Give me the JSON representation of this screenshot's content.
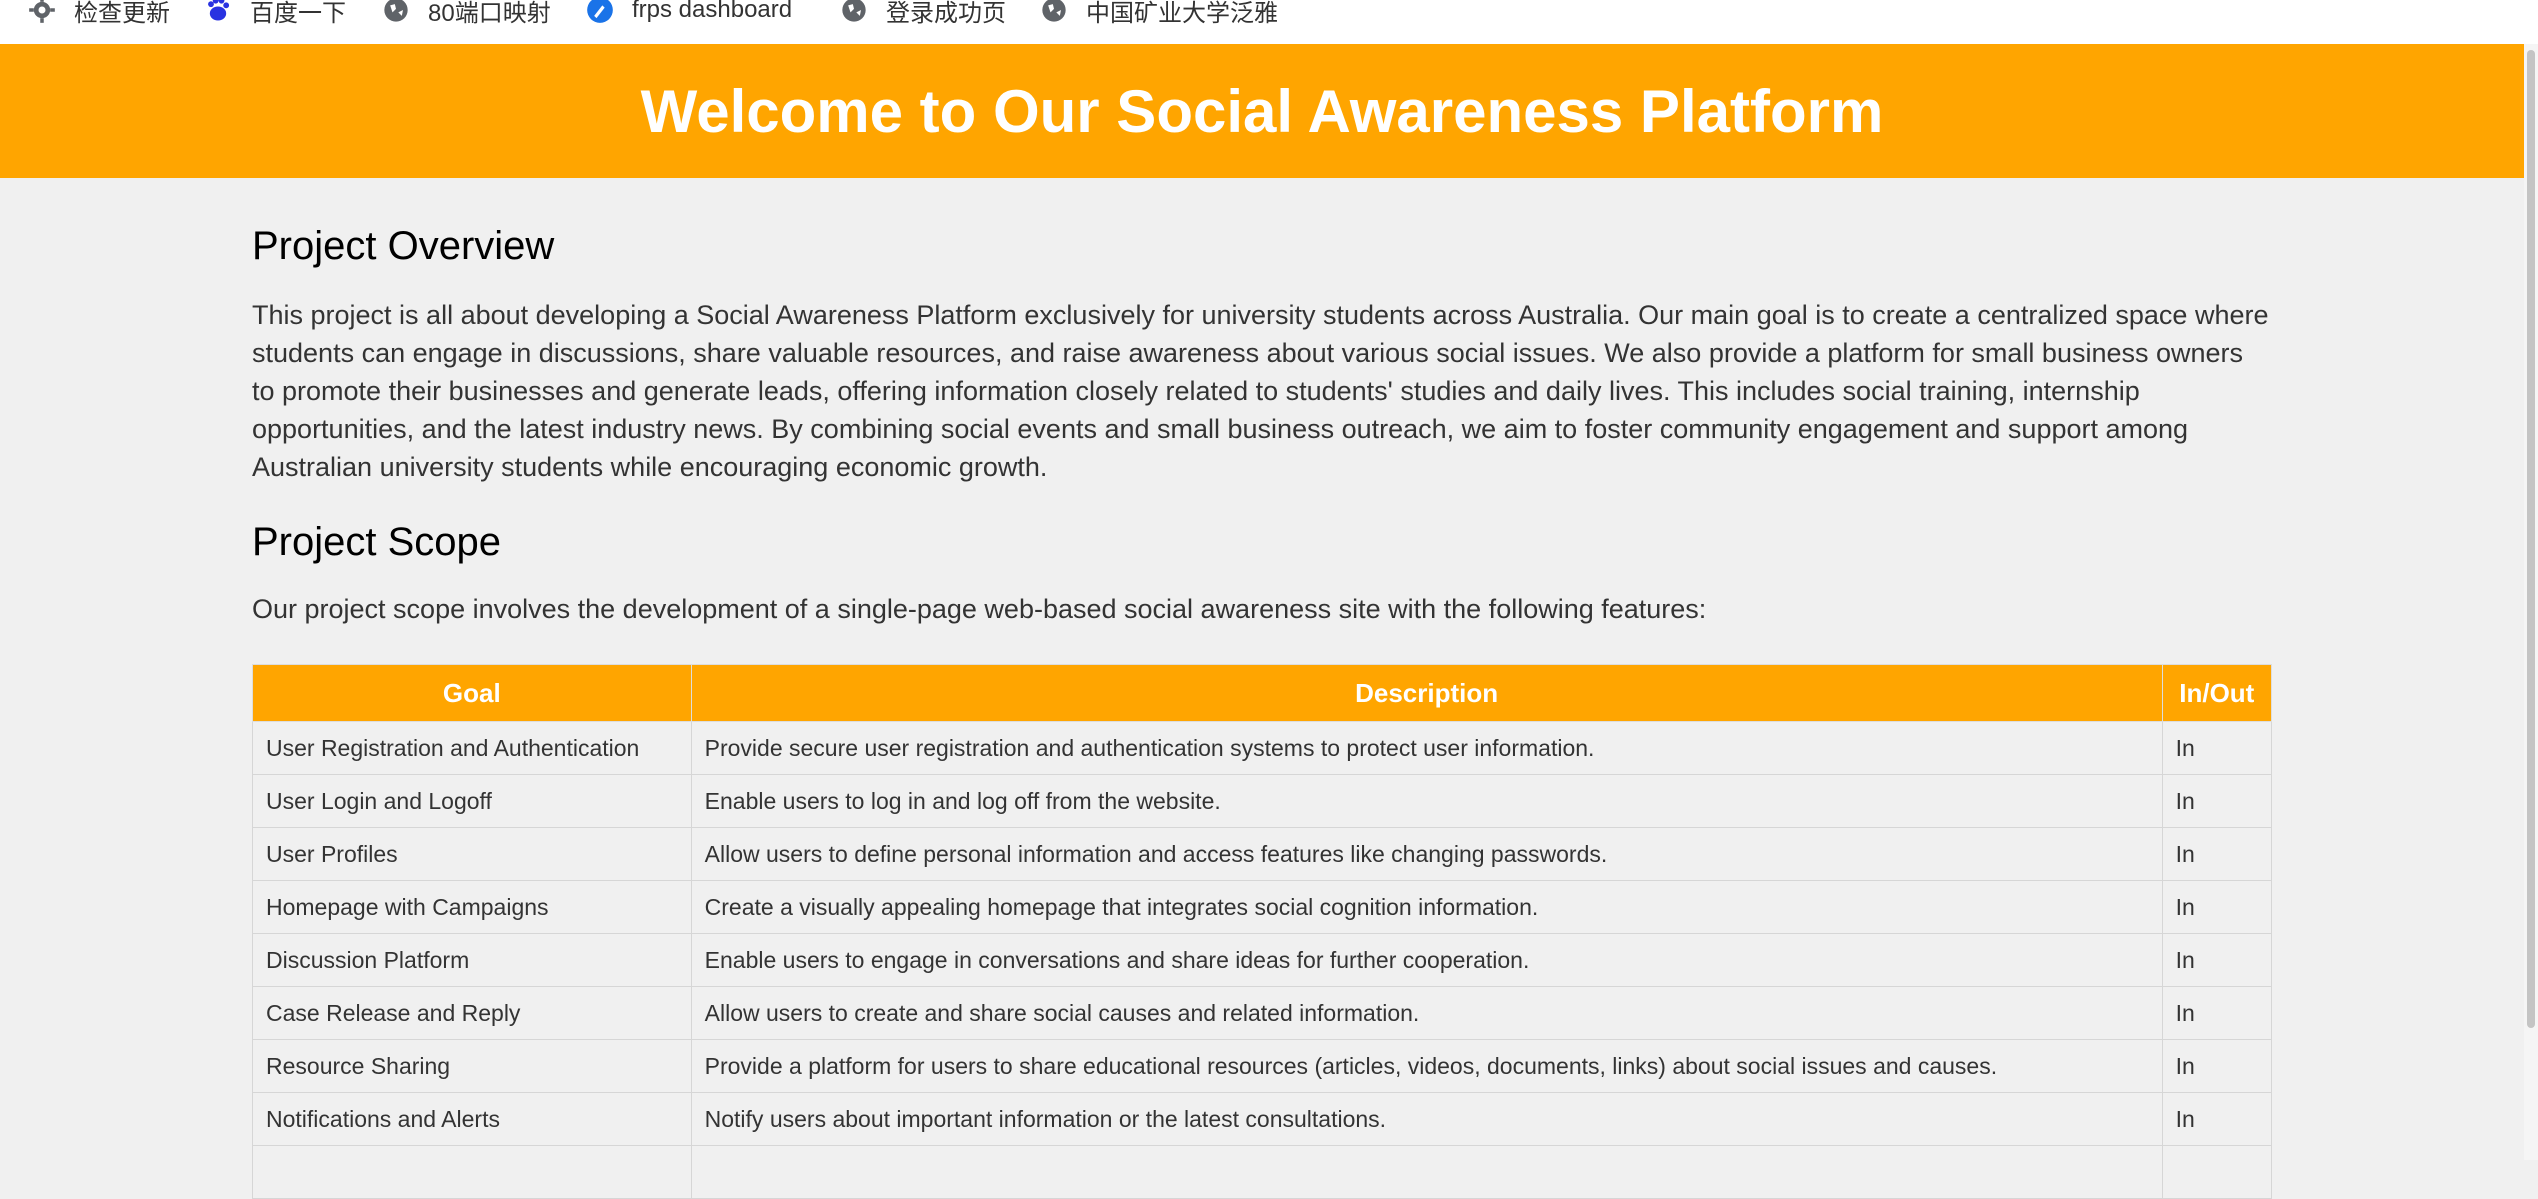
{
  "bookmarks": [
    {
      "label": "检查更新",
      "icon": "gear-icon"
    },
    {
      "label": "百度一下",
      "icon": "baidu-icon"
    },
    {
      "label": "80端口映射",
      "icon": "globe-icon"
    },
    {
      "label": "frps dashboard",
      "icon": "frps-icon"
    },
    {
      "label": "登录成功页",
      "icon": "globe-icon"
    },
    {
      "label": "中国矿业大学泛雅",
      "icon": "globe-icon"
    }
  ],
  "header": {
    "title": "Welcome to Our Social Awareness Platform"
  },
  "overview": {
    "heading": "Project Overview",
    "text": "This project is all about developing a Social Awareness Platform exclusively for university students across Australia. Our main goal is to create a centralized space where students can engage in discussions, share valuable resources, and raise awareness about various social issues. We also provide a platform for small business owners to promote their businesses and generate leads, offering information closely related to students' studies and daily lives. This includes social training, internship opportunities, and the latest industry news. By combining social events and small business outreach, we aim to foster community engagement and support among Australian university students while encouraging economic growth."
  },
  "scope": {
    "heading": "Project Scope",
    "text": "Our project scope involves the development of a single-page web-based social awareness site with the following features:",
    "table": {
      "headers": [
        "Goal",
        "Description",
        "In/Out"
      ],
      "rows": [
        [
          "User Registration and Authentication",
          "Provide secure user registration and authentication systems to protect user information.",
          "In"
        ],
        [
          "User Login and Logoff",
          "Enable users to log in and log off from the website.",
          "In"
        ],
        [
          "User Profiles",
          "Allow users to define personal information and access features like changing passwords.",
          "In"
        ],
        [
          "Homepage with Campaigns",
          "Create a visually appealing homepage that integrates social cognition information.",
          "In"
        ],
        [
          "Discussion Platform",
          "Enable users to engage in conversations and share ideas for further cooperation.",
          "In"
        ],
        [
          "Case Release and Reply",
          "Allow users to create and share social causes and related information.",
          "In"
        ],
        [
          "Resource Sharing",
          "Provide a platform for users to share educational resources (articles, videos, documents, links) about social issues and causes.",
          "In"
        ],
        [
          "Notifications and Alerts",
          "Notify users about important information or the latest consultations.",
          "In"
        ]
      ]
    }
  },
  "colors": {
    "accent": "#ffa500",
    "background": "#f0f0f0",
    "text": "#333333"
  }
}
